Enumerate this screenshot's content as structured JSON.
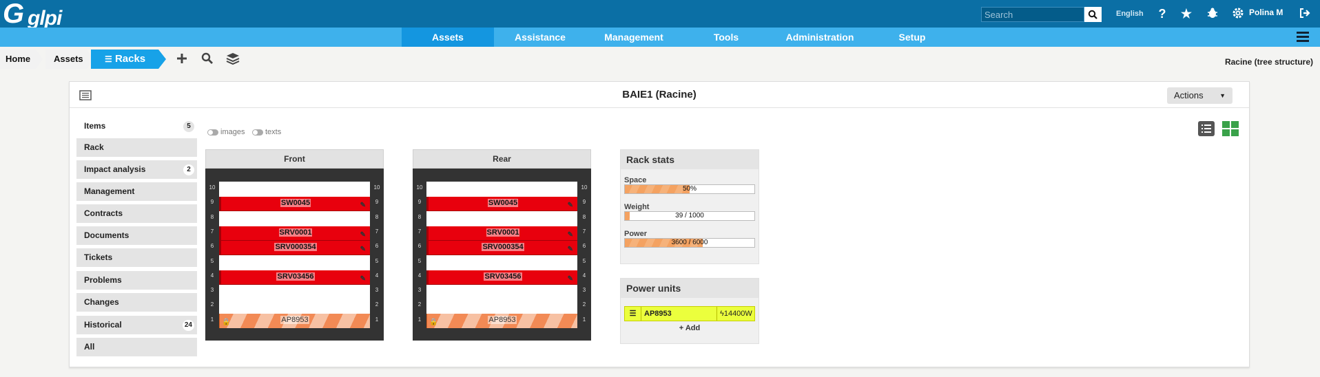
{
  "app": {
    "logo": "glpi"
  },
  "topbar": {
    "search_placeholder": "Search",
    "language": "English",
    "user": "Polina M",
    "icons": [
      "help-icon",
      "star-icon",
      "bug-icon",
      "gear-icon",
      "logout-icon"
    ]
  },
  "menu": {
    "items": [
      "Assets",
      "Assistance",
      "Management",
      "Tools",
      "Administration",
      "Setup"
    ],
    "active": "Assets"
  },
  "breadcrumb": {
    "items": [
      "Home",
      "Assets",
      "Racks"
    ],
    "entity": "Racine (tree structure)"
  },
  "card": {
    "title": "BAIE1 (Racine)",
    "actions_label": "Actions"
  },
  "tabs": [
    {
      "label": "Items",
      "badge": "5",
      "active": true
    },
    {
      "label": "Rack",
      "badge": ""
    },
    {
      "label": "Impact analysis",
      "badge": "2"
    },
    {
      "label": "Management",
      "badge": ""
    },
    {
      "label": "Contracts",
      "badge": ""
    },
    {
      "label": "Documents",
      "badge": ""
    },
    {
      "label": "Tickets",
      "badge": ""
    },
    {
      "label": "Problems",
      "badge": ""
    },
    {
      "label": "Changes",
      "badge": ""
    },
    {
      "label": "Historical",
      "badge": "24"
    },
    {
      "label": "All",
      "badge": ""
    }
  ],
  "toggles": {
    "images": "images",
    "texts": "texts"
  },
  "racks": {
    "front_label": "Front",
    "rear_label": "Rear",
    "units": [
      "10",
      "9",
      "8",
      "7",
      "6",
      "5",
      "4",
      "3",
      "2",
      "1"
    ],
    "items": [
      {
        "name": "SW0045",
        "position": 9
      },
      {
        "name": "SRV0001",
        "position": 7
      },
      {
        "name": "SRV000354",
        "position": 6
      },
      {
        "name": "SRV03456",
        "position": 4
      },
      {
        "name": "AP8953",
        "position": 1,
        "pdu": true
      }
    ]
  },
  "stats": {
    "title": "Rack stats",
    "space_label": "Space",
    "space_text": "50%",
    "space_fraction": 0.5,
    "weight_label": "Weight",
    "weight_text": "39 / 1000",
    "weight_fraction": 0.039,
    "power_label": "Power",
    "power_text": "3600 / 6000",
    "power_fraction": 0.6
  },
  "power_units": {
    "title": "Power units",
    "name": "AP8953",
    "power": "14400W",
    "add_label": "Add"
  },
  "colors": {
    "topbar": "#0b6fa5",
    "menubar": "#3eb1ec",
    "rack_item": "#e8000d",
    "pdu": "#f28a55",
    "power_unit": "#ebff3d"
  }
}
